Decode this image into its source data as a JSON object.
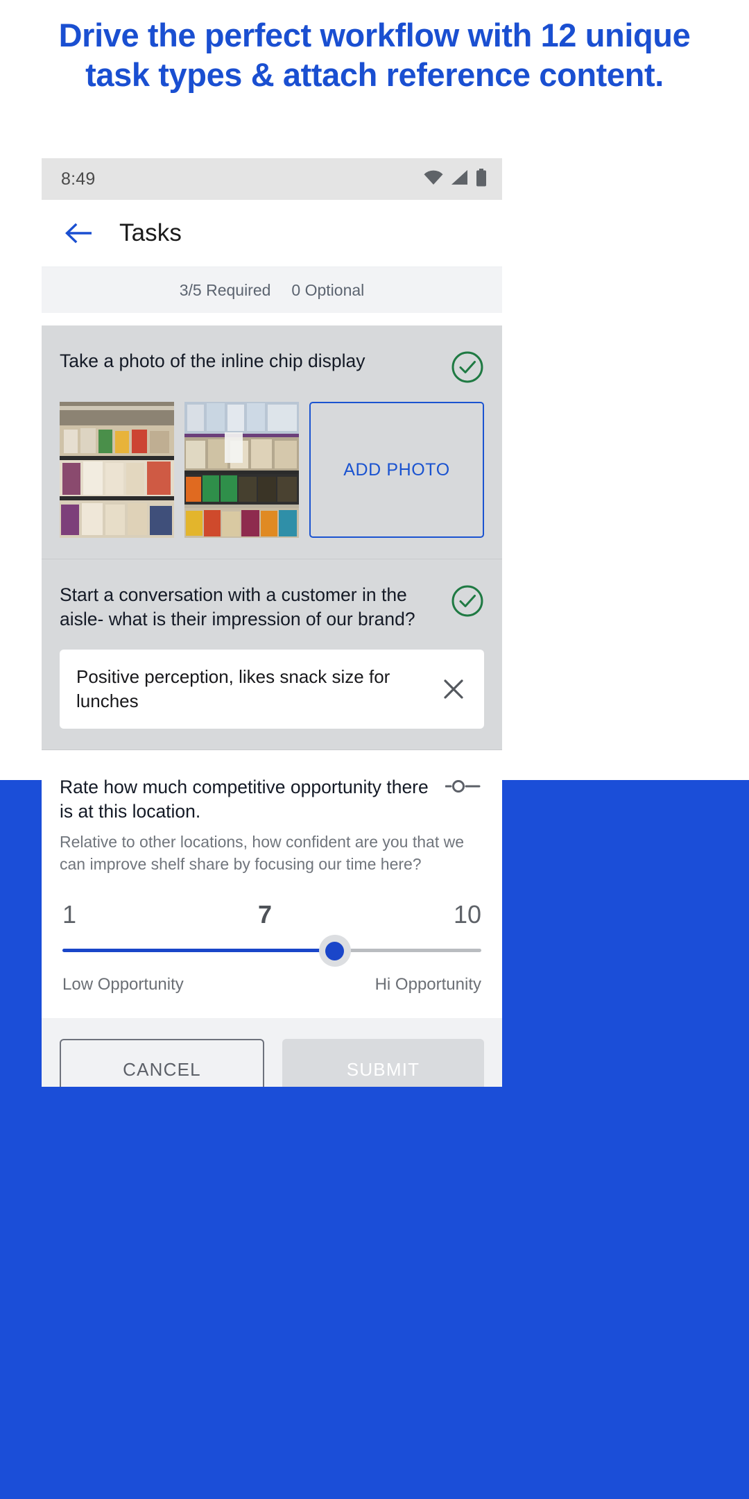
{
  "headline": "Drive the perfect workflow with 12 unique task types & attach reference content.",
  "colors": {
    "brand_blue": "#1a4fd1",
    "band_blue": "#1b4ed8",
    "accent_blue": "#1a53d0",
    "success_green": "#1f7a43",
    "task_bg": "#d7d9db"
  },
  "statusbar": {
    "time": "8:49",
    "icons": [
      "wifi-icon",
      "cell-signal-icon",
      "battery-icon"
    ]
  },
  "appbar": {
    "back_icon": "arrow-left-icon",
    "title": "Tasks"
  },
  "progress": {
    "required": "3/5 Required",
    "optional": "0 Optional"
  },
  "tasks": [
    {
      "title": "Take a photo of the inline chip display",
      "status_icon": "check-circle-icon",
      "complete": true,
      "photos": [
        "chip-aisle-photo-1",
        "chip-aisle-photo-2"
      ],
      "add_photo_label": "ADD PHOTO"
    },
    {
      "title": "Start a conversation with a customer in the aisle- what is their impression of our brand?",
      "status_icon": "check-circle-icon",
      "complete": true,
      "answer": "Positive perception, likes snack size for lunches",
      "clear_icon": "close-icon"
    }
  ],
  "rating_task": {
    "title": "Rate how much competitive opportunity there is at this location.",
    "subtitle": "Relative to other locations, how confident are you that we can improve shelf share by focusing our time here?",
    "type_icon": "slider-icon",
    "scale_min": "1",
    "scale_value": "7",
    "scale_max": "10",
    "label_low": "Low Opportunity",
    "label_high": "Hi Opportunity",
    "fill_percent": 65
  },
  "actions": {
    "cancel_label": "CANCEL",
    "submit_label": "SUBMIT"
  },
  "navbar": {
    "back_icon": "chevron-left-icon",
    "home_pill": "home-pill-icon"
  }
}
